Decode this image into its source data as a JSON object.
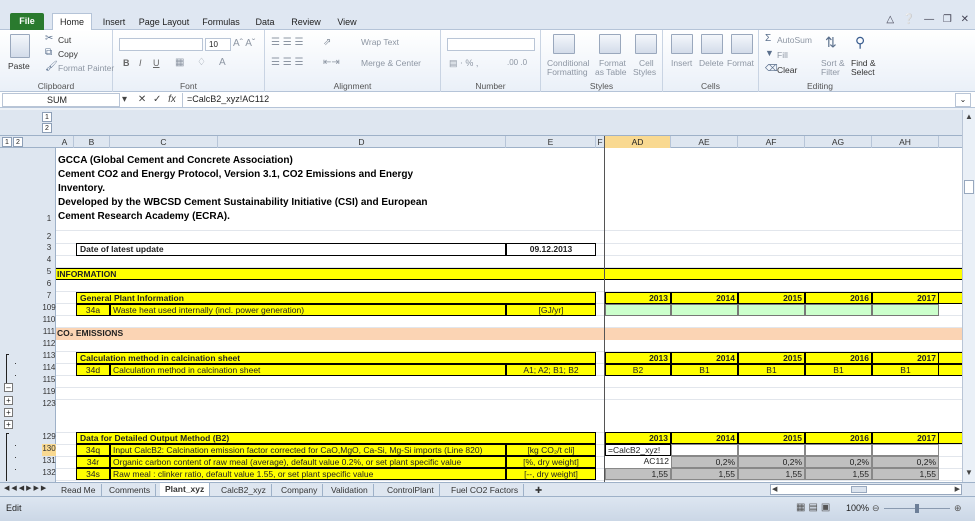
{
  "ribbon_tabs": [
    "File",
    "Home",
    "Insert",
    "Page Layout",
    "Formulas",
    "Data",
    "Review",
    "View"
  ],
  "active_tab": "Home",
  "clipboard": {
    "paste": "Paste",
    "cut": "Cut",
    "copy": "Copy",
    "format_painter": "Format Painter",
    "label": "Clipboard"
  },
  "font": {
    "name": "",
    "size": "10",
    "label": "Font"
  },
  "alignment": {
    "wrap": "Wrap Text",
    "merge": "Merge & Center",
    "label": "Alignment"
  },
  "number": {
    "format": "",
    "label": "Number"
  },
  "styles": {
    "conditional": "Conditional",
    "conditional2": "Formatting",
    "format_table": "Format",
    "format_table2": "as Table",
    "cell_styles": "Cell",
    "cell_styles2": "Styles",
    "label": "Styles"
  },
  "cells": {
    "insert": "Insert",
    "delete": "Delete",
    "format": "Format",
    "label": "Cells"
  },
  "editing": {
    "autosum": "AutoSum",
    "fill": "Fill",
    "clear": "Clear",
    "sort": "Sort &",
    "sort2": "Filter",
    "find": "Find &",
    "find2": "Select",
    "label": "Editing"
  },
  "name_box": "SUM",
  "formula": "=CalcB2_xyz!AC112",
  "outline_levels": [
    "1",
    "2"
  ],
  "columns": [
    "A",
    "B",
    "C",
    "D",
    "E",
    "F",
    "AD",
    "AE",
    "AF",
    "AG",
    "AH"
  ],
  "title_lines": [
    "GCCA (Global Cement and Concrete Association)",
    "Cement CO2 and Energy Protocol, Version 3.1, CO2 Emissions and Energy",
    "Inventory.",
    "Developed by the WBCSD Cement Sustainability Initiative (CSI) and European",
    "Cement Research Academy (ECRA)."
  ],
  "rows": [
    "1",
    "2",
    "3",
    "4",
    "5",
    "6",
    "7",
    "109",
    "110",
    "111",
    "112",
    "113",
    "114",
    "115",
    "119",
    "123",
    "129",
    "130",
    "131",
    "132"
  ],
  "date_label": "Date of latest update",
  "date_value": "09.12.2013",
  "information": "INFORMATION",
  "general_plant": "General Plant Information",
  "years": [
    "2013",
    "2014",
    "2015",
    "2016",
    "2017"
  ],
  "row109": {
    "code": "34a",
    "label": "Waste heat used internally (incl. power generation)",
    "unit": "[GJ/yr]"
  },
  "co2_emissions": "CO₂ EMISSIONS",
  "calc_method_header": "Calculation method in calcination sheet",
  "row114": {
    "code": "34d",
    "label": "Calculation method in calcination sheet",
    "unit": "A1; A2; B1; B2",
    "values": [
      "B2",
      "B1",
      "B1",
      "B1",
      "B1"
    ]
  },
  "detailed_header": "Data for Detailed Output Method (B2)",
  "row130": {
    "code": "34q",
    "label": "Input CalcB2: Calcination emission factor corrected for CaO,MgO, Ca-Si, Mg-Si imports (Line 820)",
    "unit": "[kg CO₂/t cli]",
    "edit": "=CalcB2_xyz!"
  },
  "row131": {
    "code": "34r",
    "label": "Organic carbon content of raw meal (average), default value 0.2%, or set plant specific value",
    "unit": "[%, dry weight]",
    "values": [
      "AC112",
      "0,2%",
      "0,2%",
      "0,2%",
      "0,2%"
    ]
  },
  "row132": {
    "code": "34s",
    "label": "Raw meal : clinker ratio, default value 1.55, or set plant specific value",
    "unit": "[--, dry weight]",
    "values": [
      "1,55",
      "1,55",
      "1,55",
      "1,55",
      "1,55"
    ]
  },
  "sheet_tabs": [
    "Read Me",
    "Comments",
    "Plant_xyz",
    "CalcB2_xyz",
    "Company",
    "Validation",
    "ControlPlant",
    "Fuel CO2 Factors"
  ],
  "active_sheet": "Plant_xyz",
  "status_mode": "Edit",
  "zoom": "100%"
}
